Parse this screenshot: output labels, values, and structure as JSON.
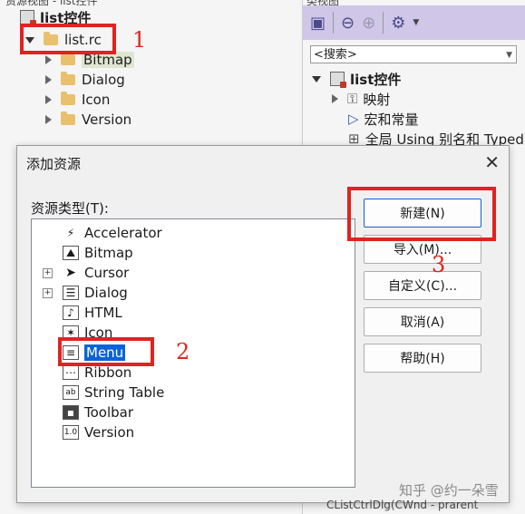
{
  "left_tree": {
    "header": "资源视图 - list控件",
    "root": "list控件",
    "file": "list.rc",
    "folders": [
      "Bitmap",
      "Dialog",
      "Icon",
      "Version"
    ]
  },
  "right_tree": {
    "header": "类视图",
    "search_text": "<搜索>",
    "root": "list控件",
    "items": [
      "映射",
      "宏和常量",
      "全局 Using 别名和 Typed"
    ],
    "bottom": "CListCtrlDlg(CWnd - prarent"
  },
  "dialog": {
    "title": "添加资源",
    "close": "✕",
    "type_label": "资源类型(T):",
    "types": [
      "Accelerator",
      "Bitmap",
      "Cursor",
      "Dialog",
      "HTML",
      "Icon",
      "Menu",
      "Ribbon",
      "String Table",
      "Toolbar",
      "Version"
    ],
    "buttons": {
      "new": "新建(N)",
      "import": "导入(M)...",
      "custom": "自定义(C)...",
      "cancel": "取消(A)",
      "help": "帮助(H)"
    }
  },
  "annotations": [
    "1",
    "2",
    "3"
  ],
  "watermark": "知乎 @约一朵雪",
  "colors": {
    "annotation_red": "#e0231f",
    "selection_blue": "#0a64d8",
    "toolbar_purple": "#cfc6e8"
  }
}
